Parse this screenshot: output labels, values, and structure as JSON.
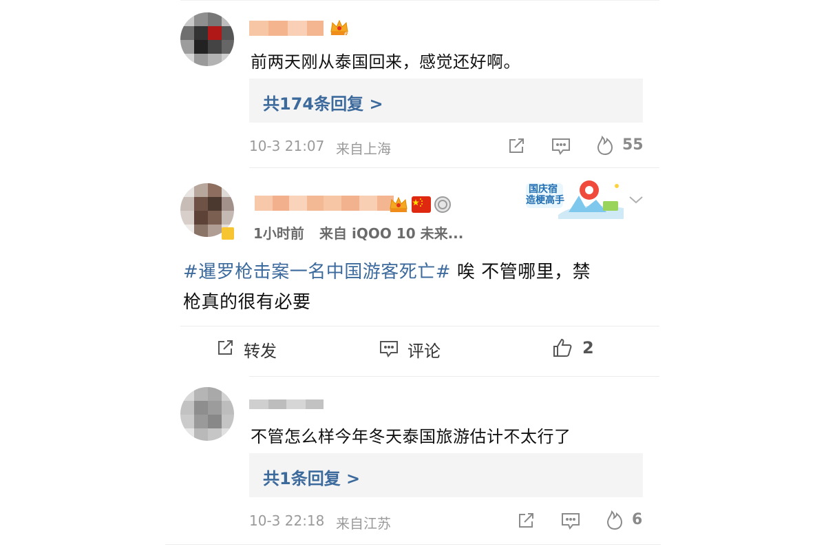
{
  "comments": [
    {
      "text": "前两天刚从泰国回来，感觉还好啊。",
      "reply_link": "共174条回复 >",
      "time": "10-3 21:07",
      "location": "来自上海",
      "likes": "55"
    },
    {
      "text": "不管怎么样今年冬天泰国旅游估计不太行了",
      "reply_link": "共1条回复 >",
      "time": "10-3 22:18",
      "location": "来自江苏",
      "likes": "6"
    }
  ],
  "post": {
    "time": "1小时前",
    "source": "来自 iQOO 10 未来...",
    "hashtag": "#暹罗枪击案一名中国游客死亡#",
    "body_line1": " 唉  不管哪里，禁",
    "body_line2": "枪真的很有必要",
    "badge_text_line1": "国庆宿",
    "badge_text_line2": "造梗高手",
    "repost_label": "转发",
    "comment_label": "评论",
    "like_count": "2"
  },
  "colors": {
    "link": "#3c6a9c",
    "meta": "#9a9a9a",
    "reply_bg": "#f4f4f4",
    "divider": "#ececec"
  }
}
